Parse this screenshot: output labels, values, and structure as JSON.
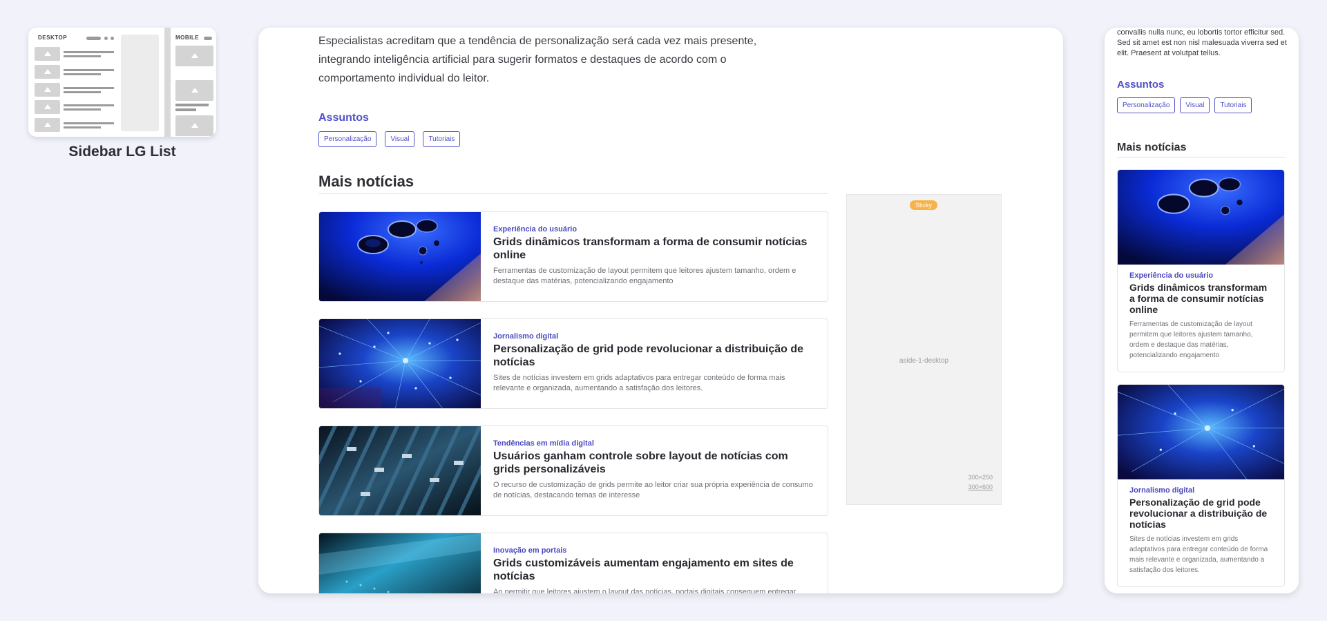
{
  "thumbnail": {
    "desktop_label": "DESKTOP",
    "mobile_label": "MOBILE",
    "title": "Sidebar LG List"
  },
  "desktop": {
    "intro": "Especialistas acreditam que a tendência de personalização será cada vez mais presente, integrando inteligência artificial para sugerir formatos e destaques de acordo com o comportamento individual do leitor.",
    "subjects_title": "Assuntos",
    "tags": [
      "Personalização",
      "Visual",
      "Tutoriais"
    ],
    "more_title": "Mais notícias",
    "articles": [
      {
        "kicker": "Experiência do usuário",
        "headline": "Grids dinâmicos transformam a forma de consumir notícias online",
        "summary": "Ferramentas de customização de layout permitem que leitores ajustem tamanho, ordem e destaque das matérias, potencializando engajamento"
      },
      {
        "kicker": "Jornalismo digital",
        "headline": "Personalização de grid pode revolucionar a distribuição de notícias",
        "summary": "Sites de notícias investem em grids adaptativos para entregar conteúdo de forma mais relevante e organizada, aumentando a satisfação dos leitores."
      },
      {
        "kicker": "Tendências em mídia digital",
        "headline": "Usuários ganham controle sobre layout de notícias com grids personalizáveis",
        "summary": "O recurso de customização de grids permite ao leitor criar sua própria experiência de consumo de notícias, destacando temas de interesse"
      },
      {
        "kicker": "Inovação em portais",
        "headline": "Grids customizáveis aumentam engajamento em sites de notícias",
        "summary": "Ao permitir que leitores ajustem o layout das notícias, portais digitais conseguem entregar"
      }
    ],
    "aside": {
      "sticky": "Sticky",
      "label": "aside-1-desktop",
      "size1": "300×250",
      "size2": "300×600"
    }
  },
  "mobile": {
    "intro": "convallis nulla nunc, eu lobortis tortor efficitur sed. Sed sit amet est non nisl malesuada viverra sed et elit. Praesent at volutpat tellus.",
    "subjects_title": "Assuntos",
    "tags": [
      "Personalização",
      "Visual",
      "Tutoriais"
    ],
    "more_title": "Mais notícias",
    "articles": [
      {
        "kicker": "Experiência do usuário",
        "headline": "Grids dinâmicos transformam a forma de consumir notícias online",
        "summary": "Ferramentas de customização de layout permitem que leitores ajustem tamanho, ordem e destaque das matérias, potencializando engajamento"
      },
      {
        "kicker": "Jornalismo digital",
        "headline": "Personalização de grid pode revolucionar a distribuição de notícias",
        "summary": "Sites de notícias investem em grids adaptativos para entregar conteúdo de forma mais relevante e organizada, aumentando a satisfação dos leitores."
      }
    ]
  },
  "colors": {
    "accent": "#5050c8",
    "sticky": "#f7b24a",
    "background": "#f1f2fa"
  }
}
